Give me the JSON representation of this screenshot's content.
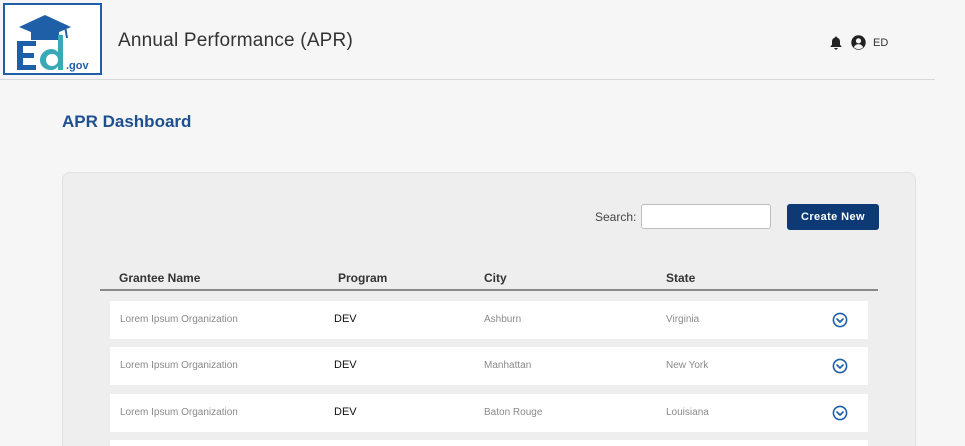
{
  "header": {
    "logo_text": "Ed.gov",
    "app_title": "Annual Performance (APR)",
    "notification_icon": "bell-icon",
    "user_icon": "user-circle-icon",
    "user_initials": "ED"
  },
  "dashboard": {
    "title": "APR Dashboard",
    "search": {
      "label": "Search:",
      "value": "",
      "placeholder": ""
    },
    "create_button": "Create New"
  },
  "table": {
    "columns": [
      "Grantee Name",
      "Program",
      "City",
      "State"
    ],
    "rows": [
      {
        "grantee": "Lorem Ipsum Organization",
        "program": "DEV",
        "city": "Ashburn",
        "state": "Virginia"
      },
      {
        "grantee": "Lorem Ipsum Organization",
        "program": "DEV",
        "city": "Manhattan",
        "state": "New York"
      },
      {
        "grantee": "Lorem Ipsum Organization",
        "program": "DEV",
        "city": "Baton Rouge",
        "state": "Louisiana"
      }
    ],
    "expand_icon": "chevron-down-circle-icon"
  },
  "colors": {
    "brand_blue": "#1e4f8e",
    "button_navy": "#0d3a74",
    "logo_teal": "#3aa8b5",
    "page_bg": "#f6f6f6"
  }
}
